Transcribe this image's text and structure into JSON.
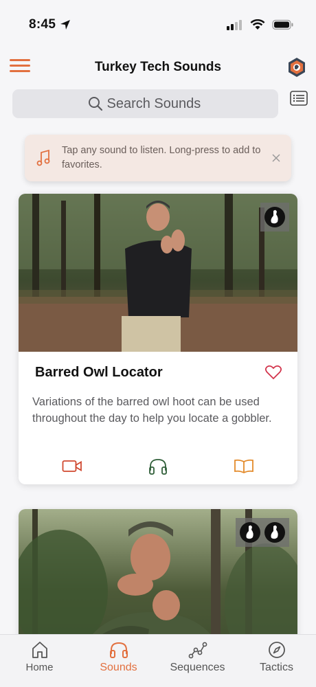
{
  "status": {
    "time": "8:45"
  },
  "header": {
    "title": "Turkey Tech Sounds"
  },
  "search": {
    "placeholder": "Search Sounds"
  },
  "tip": {
    "text": "Tap any sound to listen. Long-press to add to favorites."
  },
  "cards": [
    {
      "title": "Barred Owl Locator",
      "description": "Variations of the barred owl hoot can be used throughout the day to help you locate a gobbler.",
      "badge_count": 1
    },
    {
      "title": "",
      "description": "",
      "badge_count": 2
    }
  ],
  "tabs": [
    {
      "label": "Home",
      "icon": "home-icon",
      "active": false
    },
    {
      "label": "Sounds",
      "icon": "headphones-icon",
      "active": true
    },
    {
      "label": "Sequences",
      "icon": "sequence-graph-icon",
      "active": false
    },
    {
      "label": "Tactics",
      "icon": "compass-icon",
      "active": false
    }
  ],
  "colors": {
    "accent": "#e2703f",
    "green": "#2f5e38",
    "video_red": "#d0482f",
    "book_orange": "#e38a2a",
    "heart_red": "#d2324a"
  }
}
